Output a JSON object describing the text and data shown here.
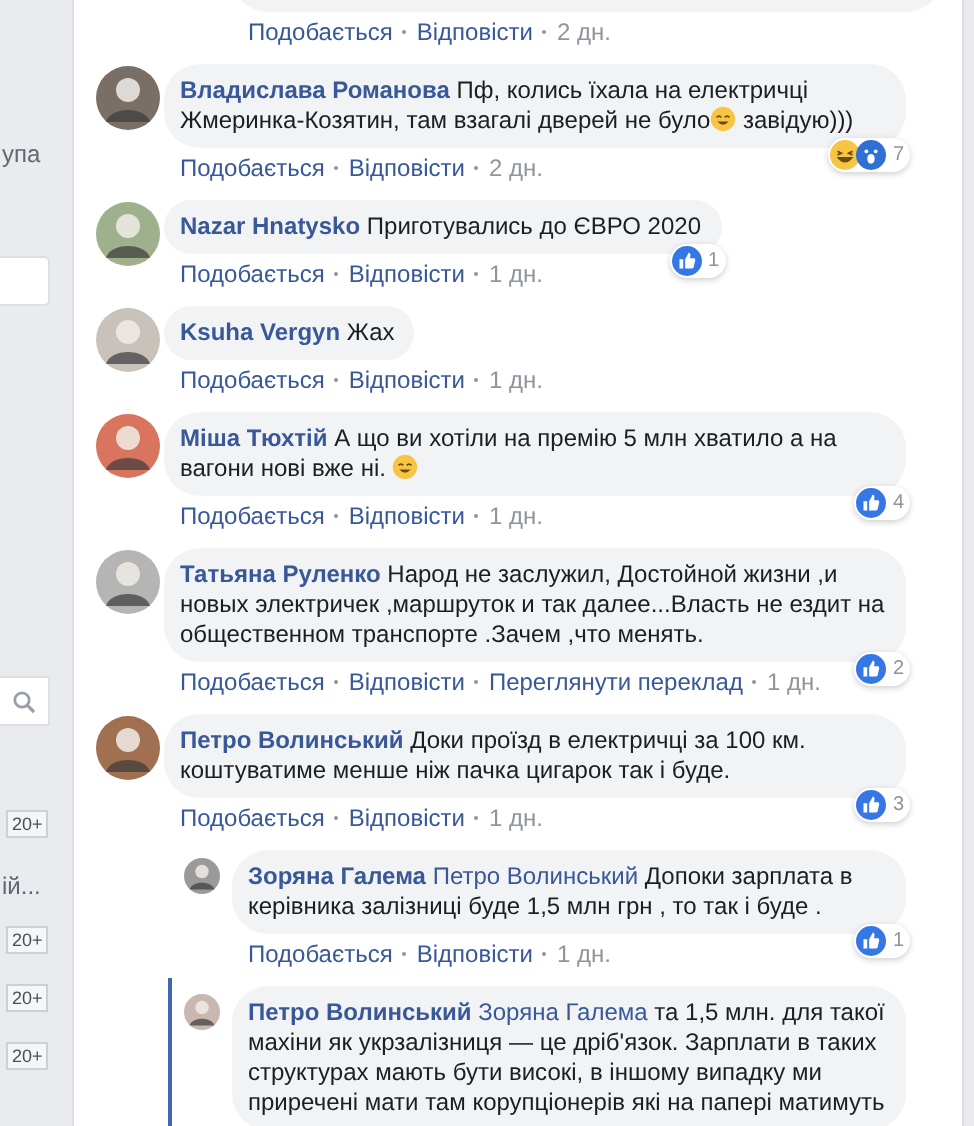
{
  "sidebar": {
    "items": [
      {
        "kind": "label",
        "text": "упа"
      },
      {
        "kind": "card"
      },
      {
        "kind": "search"
      },
      {
        "kind": "badge",
        "text": "20+"
      },
      {
        "kind": "label",
        "text": "ій..."
      },
      {
        "kind": "badge",
        "text": "20+"
      },
      {
        "kind": "badge",
        "text": "20+"
      },
      {
        "kind": "badge",
        "text": "20+"
      }
    ]
  },
  "comments": [
    {
      "kind": "stub",
      "actions": [
        "Подобається",
        "Відповісти"
      ],
      "time": "2 дн."
    },
    {
      "kind": "comment",
      "name": "Владислава Романова",
      "text": [
        {
          "kind": "text",
          "t": "Пф, колись їхала на електричці Жмеринка-Козятин, там взагалі дверей не було"
        },
        {
          "kind": "emoji"
        },
        {
          "kind": "text",
          "t": " завідую)))"
        }
      ],
      "reactions": [
        {
          "kind": "haha"
        },
        {
          "kind": "wow"
        }
      ],
      "count": "7",
      "actions": [
        "Подобається",
        "Відповісти"
      ],
      "time": "2 дн."
    },
    {
      "kind": "comment",
      "name": "Nazar Hnatysko",
      "text": [
        {
          "kind": "text",
          "t": "Приготувались до ЄВРО 2020"
        }
      ],
      "reactions": [
        {
          "kind": "like"
        }
      ],
      "count": "1",
      "actions": [
        "Подобається",
        "Відповісти"
      ],
      "time": "1 дн."
    },
    {
      "kind": "comment",
      "name": "Ksuha Vergyn",
      "text": [
        {
          "kind": "text",
          "t": "Жах"
        }
      ],
      "actions": [
        "Подобається",
        "Відповісти"
      ],
      "time": "1 дн."
    },
    {
      "kind": "comment",
      "name": "Міша Тюхтій",
      "text": [
        {
          "kind": "text",
          "t": "А що ви хотіли на премію 5 млн хватило а на вагони нові вже ні. "
        },
        {
          "kind": "emoji"
        }
      ],
      "reactions": [
        {
          "kind": "like"
        }
      ],
      "count": "4",
      "actions": [
        "Подобається",
        "Відповісти"
      ],
      "time": "1 дн."
    },
    {
      "kind": "comment",
      "name": "Татьяна Руленко",
      "text": [
        {
          "kind": "text",
          "t": "Народ не заслужил, Достойной жизни ,и новых электричек ,маршруток и так далее...Власть не ездит на общественном транспорте .Зачем ,что менять."
        }
      ],
      "reactions": [
        {
          "kind": "like"
        }
      ],
      "count": "2",
      "actions": [
        "Подобається",
        "Відповісти",
        "Переглянути переклад"
      ],
      "time": "1 дн."
    },
    {
      "kind": "comment",
      "name": "Петро Волинський",
      "text": [
        {
          "kind": "text",
          "t": "Доки проїзд в електричці за 100 км. коштуватиме менше ніж пачка цигарок так і буде."
        }
      ],
      "reactions": [
        {
          "kind": "like"
        }
      ],
      "count": "3",
      "actions": [
        "Подобається",
        "Відповісти"
      ],
      "time": "1 дн."
    },
    {
      "kind": "reply",
      "highlighted": false,
      "name": "Зоряна Галема",
      "mention": "Петро Волинський",
      "text": [
        {
          "kind": "text",
          "t": "Допоки зарплата в керівника залізниці буде 1,5 млн грн , то так і буде ."
        }
      ],
      "reactions": [
        {
          "kind": "like"
        }
      ],
      "count": "1",
      "actions": [
        "Подобається",
        "Відповісти"
      ],
      "time": "1 дн."
    },
    {
      "kind": "reply",
      "highlighted": true,
      "name": "Петро Волинський",
      "mention": "Зоряна Галема",
      "text": [
        {
          "kind": "text",
          "t": "та 1,5 млн. для такої махіни як укрзалізниця — це дріб'язок. Зарплати в таких структурах мають бути високі, в іншому випадку ми приречені мати там корупціонерів які на папері матимуть"
        }
      ]
    }
  ]
}
